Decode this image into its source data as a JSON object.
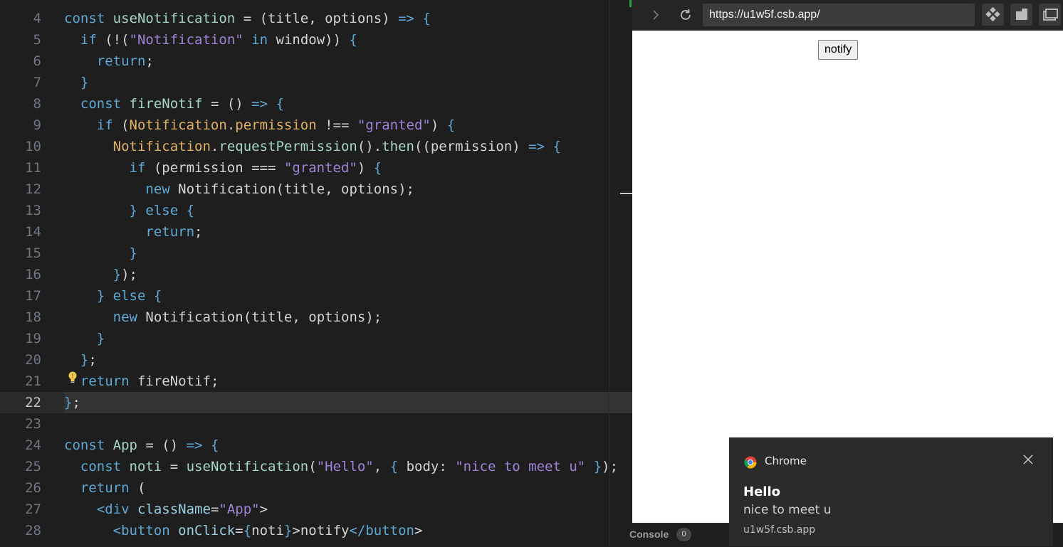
{
  "editor": {
    "lines": [
      {
        "n": "4",
        "code": "const useNotification = (title, options) => {"
      },
      {
        "n": "5",
        "code": "  if (!(\"Notification\" in window)) {"
      },
      {
        "n": "6",
        "code": "    return;"
      },
      {
        "n": "7",
        "code": "  }"
      },
      {
        "n": "8",
        "code": "  const fireNotif = () => {"
      },
      {
        "n": "9",
        "code": "    if (Notification.permission !== \"granted\") {"
      },
      {
        "n": "10",
        "code": "      Notification.requestPermission().then((permission) => {"
      },
      {
        "n": "11",
        "code": "        if (permission === \"granted\") {"
      },
      {
        "n": "12",
        "code": "          new Notification(title, options);"
      },
      {
        "n": "13",
        "code": "        } else {"
      },
      {
        "n": "14",
        "code": "          return;"
      },
      {
        "n": "15",
        "code": "        }"
      },
      {
        "n": "16",
        "code": "      });"
      },
      {
        "n": "17",
        "code": "    } else {"
      },
      {
        "n": "18",
        "code": "      new Notification(title, options);"
      },
      {
        "n": "19",
        "code": "    }"
      },
      {
        "n": "20",
        "code": "  };"
      },
      {
        "n": "21",
        "code": "  return fireNotif;"
      },
      {
        "n": "22",
        "code": "};"
      },
      {
        "n": "23",
        "code": ""
      },
      {
        "n": "24",
        "code": "const App = () => {"
      },
      {
        "n": "25",
        "code": "  const noti = useNotification(\"Hello\", { body: \"nice to meet u\" });"
      },
      {
        "n": "26",
        "code": "  return ("
      },
      {
        "n": "27",
        "code": "    <div className=\"App\">"
      },
      {
        "n": "28",
        "code": "      <button onClick={noti}>notify</button>"
      }
    ],
    "current_line": "22"
  },
  "browser": {
    "url": "https://u1w5f.csb.app/",
    "page_button_label": "notify",
    "console_label": "Console",
    "console_count": "0"
  },
  "notification": {
    "app_name": "Chrome",
    "title": "Hello",
    "body": "nice to meet u",
    "origin": "u1w5f.csb.app"
  },
  "colors": {
    "editor_bg": "#1e1e1e",
    "keyword": "#5ea8d6",
    "string": "#9e83d7",
    "class": "#e0b161",
    "function": "#a6d5c6",
    "toast_bg": "#2b2b2b"
  }
}
